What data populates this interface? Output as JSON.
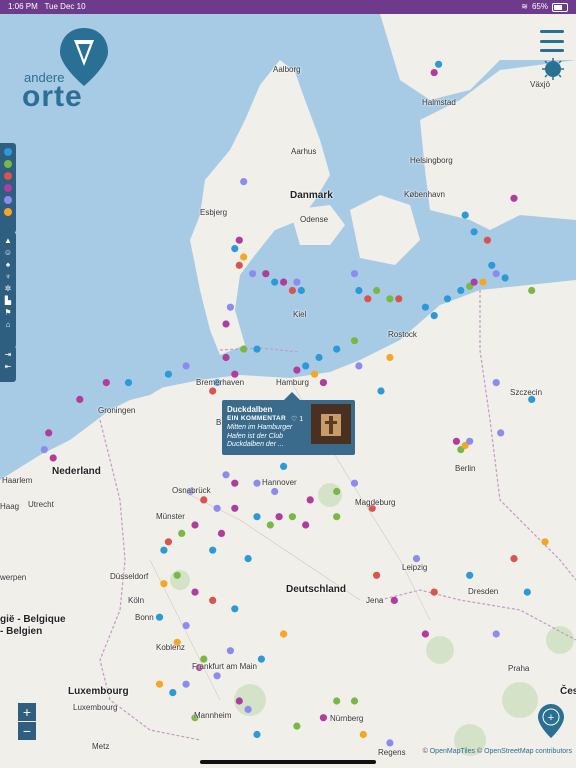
{
  "status_bar": {
    "time": "1:06 PM",
    "date": "Tue Dec 10",
    "battery": "65%"
  },
  "logo": {
    "line1": "andere",
    "line2": "orte"
  },
  "map_labels": {
    "aalborg": "Aalborg",
    "halmstad": "Halmstad",
    "vaxjo": "Växjö",
    "aarhus": "Aarhus",
    "helsingborg": "Helsingborg",
    "danmark": "Danmark",
    "kobenhavn": "København",
    "esbjerg": "Esbjerg",
    "odense": "Odense",
    "kiel": "Kiel",
    "rostock": "Rostock",
    "szczecin": "Szczecin",
    "groningen": "Groningen",
    "bremerhaven": "Bremerhaven",
    "hamburg": "Hamburg",
    "bremen": "Bre",
    "nederland": "Nederland",
    "haarlem": "Haarlem",
    "haag": "Haag",
    "utrecht": "Utrecht",
    "osnabruck": "Osnabrück",
    "hannover": "Hannover",
    "magdeburg": "Magdeburg",
    "berlin": "Berlin",
    "munster": "Münster",
    "dusseldorf": "Düsseldorf",
    "kerpen": "werpen",
    "koln": "Köln",
    "bonn": "Bonn",
    "deutschland": "Deutschland",
    "leipzig": "Leipzig",
    "dresden": "Dresden",
    "jena": "Jena",
    "belgique1": "gië - Belgique",
    "belgique2": "- Belgien",
    "koblenz": "Koblenz",
    "frankfurt": "Frankfurt am Main",
    "praha": "Praha",
    "luxembourg1": "Luxembourg",
    "luxembourg2": "Luxembourg",
    "mannheim": "Mannheim",
    "nurnberg": "Nürnberg",
    "regensburg": "Regens",
    "ceska": "Česk",
    "metz": "Metz"
  },
  "popup": {
    "title": "Duckdalben",
    "subtitle": "EIN KOMMENTAR",
    "likes": "♡ 1",
    "description": "Mitten im Hamburger Hafen ist der Club Duckdalben der ..."
  },
  "zoom": {
    "in": "+",
    "out": "−"
  },
  "attribution": {
    "prefix": "© ",
    "omt": "OpenMapTiles",
    "sep": " © ",
    "osm": "OpenStreetMap contributors"
  },
  "category_colors": [
    "#2c9ad8",
    "#7ab846",
    "#d9534f",
    "#b03c9e",
    "#8c8cf0",
    "#f5a623"
  ],
  "feature_icons": [
    "tent-icon",
    "smiley-icon",
    "tree-icon",
    "pin-icon",
    "bike-icon",
    "boot-icon",
    "flag-icon",
    "house-icon"
  ],
  "action_icons": [
    "export-icon",
    "import-icon"
  ],
  "markers": [
    {
      "lat": 56.9,
      "lon": 12.8,
      "c": 3
    },
    {
      "lat": 57.0,
      "lon": 12.9,
      "c": 0
    },
    {
      "lat": 55.4,
      "lon": 14.6,
      "c": 3
    },
    {
      "lat": 55.6,
      "lon": 8.5,
      "c": 4
    },
    {
      "lat": 55.2,
      "lon": 13.5,
      "c": 0
    },
    {
      "lat": 55.0,
      "lon": 13.7,
      "c": 0
    },
    {
      "lat": 54.9,
      "lon": 14.0,
      "c": 2
    },
    {
      "lat": 54.6,
      "lon": 14.1,
      "c": 0
    },
    {
      "lat": 54.9,
      "lon": 8.4,
      "c": 3
    },
    {
      "lat": 54.8,
      "lon": 8.3,
      "c": 0
    },
    {
      "lat": 54.7,
      "lon": 8.5,
      "c": 5
    },
    {
      "lat": 54.6,
      "lon": 8.4,
      "c": 2
    },
    {
      "lat": 54.5,
      "lon": 8.7,
      "c": 4
    },
    {
      "lat": 54.5,
      "lon": 9.0,
      "c": 3
    },
    {
      "lat": 54.4,
      "lon": 9.2,
      "c": 0
    },
    {
      "lat": 54.4,
      "lon": 9.4,
      "c": 3
    },
    {
      "lat": 54.4,
      "lon": 9.7,
      "c": 4
    },
    {
      "lat": 54.3,
      "lon": 9.8,
      "c": 0
    },
    {
      "lat": 54.3,
      "lon": 9.6,
      "c": 2
    },
    {
      "lat": 54.5,
      "lon": 11.0,
      "c": 4
    },
    {
      "lat": 54.3,
      "lon": 11.1,
      "c": 0
    },
    {
      "lat": 54.2,
      "lon": 11.3,
      "c": 2
    },
    {
      "lat": 54.3,
      "lon": 11.5,
      "c": 1
    },
    {
      "lat": 54.2,
      "lon": 11.8,
      "c": 1
    },
    {
      "lat": 54.2,
      "lon": 12.0,
      "c": 2
    },
    {
      "lat": 54.1,
      "lon": 12.6,
      "c": 0
    },
    {
      "lat": 54.0,
      "lon": 12.8,
      "c": 0
    },
    {
      "lat": 54.2,
      "lon": 13.1,
      "c": 0
    },
    {
      "lat": 54.3,
      "lon": 13.4,
      "c": 0
    },
    {
      "lat": 54.35,
      "lon": 13.6,
      "c": 1
    },
    {
      "lat": 54.4,
      "lon": 13.7,
      "c": 3
    },
    {
      "lat": 54.4,
      "lon": 13.9,
      "c": 5
    },
    {
      "lat": 54.5,
      "lon": 14.2,
      "c": 4
    },
    {
      "lat": 54.45,
      "lon": 14.4,
      "c": 0
    },
    {
      "lat": 54.3,
      "lon": 15.0,
      "c": 1
    },
    {
      "lat": 54.1,
      "lon": 8.2,
      "c": 4
    },
    {
      "lat": 53.9,
      "lon": 8.1,
      "c": 3
    },
    {
      "lat": 53.6,
      "lon": 8.8,
      "c": 0
    },
    {
      "lat": 53.5,
      "lon": 8.1,
      "c": 3
    },
    {
      "lat": 53.6,
      "lon": 8.5,
      "c": 1
    },
    {
      "lat": 53.3,
      "lon": 8.3,
      "c": 3
    },
    {
      "lat": 53.1,
      "lon": 7.8,
      "c": 2
    },
    {
      "lat": 53.2,
      "lon": 7.9,
      "c": 0
    },
    {
      "lat": 53.4,
      "lon": 7.2,
      "c": 4
    },
    {
      "lat": 53.3,
      "lon": 6.8,
      "c": 0
    },
    {
      "lat": 53.2,
      "lon": 5.9,
      "c": 0
    },
    {
      "lat": 53.2,
      "lon": 5.4,
      "c": 3
    },
    {
      "lat": 53.0,
      "lon": 4.8,
      "c": 3
    },
    {
      "lat": 52.6,
      "lon": 4.1,
      "c": 3
    },
    {
      "lat": 52.4,
      "lon": 4.0,
      "c": 4
    },
    {
      "lat": 52.3,
      "lon": 4.2,
      "c": 3
    },
    {
      "lat": 52.5,
      "lon": 9.6,
      "c": 3
    },
    {
      "lat": 53.35,
      "lon": 9.7,
      "c": 3
    },
    {
      "lat": 53.4,
      "lon": 9.9,
      "c": 0
    },
    {
      "lat": 53.3,
      "lon": 10.1,
      "c": 5
    },
    {
      "lat": 53.2,
      "lon": 10.3,
      "c": 3
    },
    {
      "lat": 53.5,
      "lon": 10.2,
      "c": 0
    },
    {
      "lat": 53.7,
      "lon": 11.0,
      "c": 1
    },
    {
      "lat": 53.6,
      "lon": 10.6,
      "c": 0
    },
    {
      "lat": 53.4,
      "lon": 11.1,
      "c": 4
    },
    {
      "lat": 53.1,
      "lon": 11.6,
      "c": 0
    },
    {
      "lat": 52.9,
      "lon": 9.4,
      "c": 4
    },
    {
      "lat": 52.7,
      "lon": 9.6,
      "c": 5
    },
    {
      "lat": 52.4,
      "lon": 13.4,
      "c": 1
    },
    {
      "lat": 52.45,
      "lon": 13.5,
      "c": 5
    },
    {
      "lat": 52.5,
      "lon": 13.3,
      "c": 3
    },
    {
      "lat": 52.5,
      "lon": 13.6,
      "c": 4
    },
    {
      "lat": 52.2,
      "lon": 9.4,
      "c": 0
    },
    {
      "lat": 52.1,
      "lon": 8.1,
      "c": 4
    },
    {
      "lat": 52.0,
      "lon": 8.3,
      "c": 3
    },
    {
      "lat": 52.0,
      "lon": 8.8,
      "c": 4
    },
    {
      "lat": 51.9,
      "lon": 9.2,
      "c": 4
    },
    {
      "lat": 51.8,
      "lon": 10.0,
      "c": 3
    },
    {
      "lat": 51.9,
      "lon": 10.6,
      "c": 1
    },
    {
      "lat": 52.0,
      "lon": 11.0,
      "c": 4
    },
    {
      "lat": 51.7,
      "lon": 11.4,
      "c": 2
    },
    {
      "lat": 51.6,
      "lon": 10.6,
      "c": 1
    },
    {
      "lat": 51.9,
      "lon": 7.3,
      "c": 4
    },
    {
      "lat": 51.8,
      "lon": 7.6,
      "c": 2
    },
    {
      "lat": 51.7,
      "lon": 7.9,
      "c": 4
    },
    {
      "lat": 51.7,
      "lon": 8.3,
      "c": 3
    },
    {
      "lat": 51.6,
      "lon": 8.8,
      "c": 0
    },
    {
      "lat": 51.5,
      "lon": 9.1,
      "c": 1
    },
    {
      "lat": 51.6,
      "lon": 9.6,
      "c": 1
    },
    {
      "lat": 51.5,
      "lon": 9.9,
      "c": 3
    },
    {
      "lat": 51.6,
      "lon": 9.3,
      "c": 3
    },
    {
      "lat": 51.4,
      "lon": 8.0,
      "c": 3
    },
    {
      "lat": 51.5,
      "lon": 7.4,
      "c": 3
    },
    {
      "lat": 51.4,
      "lon": 7.1,
      "c": 1
    },
    {
      "lat": 51.3,
      "lon": 6.8,
      "c": 2
    },
    {
      "lat": 51.2,
      "lon": 6.7,
      "c": 0
    },
    {
      "lat": 51.2,
      "lon": 7.8,
      "c": 0
    },
    {
      "lat": 51.1,
      "lon": 8.6,
      "c": 0
    },
    {
      "lat": 50.9,
      "lon": 7.0,
      "c": 1
    },
    {
      "lat": 50.8,
      "lon": 6.7,
      "c": 5
    },
    {
      "lat": 50.7,
      "lon": 7.4,
      "c": 3
    },
    {
      "lat": 50.6,
      "lon": 7.8,
      "c": 2
    },
    {
      "lat": 50.5,
      "lon": 8.3,
      "c": 0
    },
    {
      "lat": 50.4,
      "lon": 6.6,
      "c": 0
    },
    {
      "lat": 50.3,
      "lon": 7.2,
      "c": 4
    },
    {
      "lat": 50.1,
      "lon": 7.0,
      "c": 5
    },
    {
      "lat": 50.0,
      "lon": 8.2,
      "c": 4
    },
    {
      "lat": 49.9,
      "lon": 7.6,
      "c": 1
    },
    {
      "lat": 50.2,
      "lon": 9.4,
      "c": 5
    },
    {
      "lat": 49.9,
      "lon": 8.9,
      "c": 0
    },
    {
      "lat": 49.8,
      "lon": 7.5,
      "c": 3
    },
    {
      "lat": 49.7,
      "lon": 7.9,
      "c": 4
    },
    {
      "lat": 49.6,
      "lon": 6.6,
      "c": 5
    },
    {
      "lat": 49.6,
      "lon": 7.2,
      "c": 4
    },
    {
      "lat": 49.5,
      "lon": 6.9,
      "c": 0
    },
    {
      "lat": 49.4,
      "lon": 8.4,
      "c": 3
    },
    {
      "lat": 49.3,
      "lon": 8.6,
      "c": 4
    },
    {
      "lat": 49.2,
      "lon": 7.4,
      "c": 1
    },
    {
      "lat": 49.0,
      "lon": 8.8,
      "c": 0
    },
    {
      "lat": 49.1,
      "lon": 9.7,
      "c": 1
    },
    {
      "lat": 49.2,
      "lon": 10.3,
      "c": 3
    },
    {
      "lat": 49.4,
      "lon": 10.6,
      "c": 1
    },
    {
      "lat": 49.4,
      "lon": 11.0,
      "c": 1
    },
    {
      "lat": 49.0,
      "lon": 11.2,
      "c": 5
    },
    {
      "lat": 48.9,
      "lon": 11.8,
      "c": 4
    },
    {
      "lat": 50.2,
      "lon": 12.6,
      "c": 3
    },
    {
      "lat": 50.9,
      "lon": 11.5,
      "c": 2
    },
    {
      "lat": 50.6,
      "lon": 11.9,
      "c": 3
    },
    {
      "lat": 51.1,
      "lon": 12.4,
      "c": 4
    },
    {
      "lat": 50.7,
      "lon": 12.8,
      "c": 2
    },
    {
      "lat": 50.9,
      "lon": 13.6,
      "c": 0
    },
    {
      "lat": 50.2,
      "lon": 14.2,
      "c": 4
    },
    {
      "lat": 51.1,
      "lon": 14.6,
      "c": 2
    },
    {
      "lat": 50.7,
      "lon": 14.9,
      "c": 0
    },
    {
      "lat": 51.3,
      "lon": 15.3,
      "c": 5
    },
    {
      "lat": 52.6,
      "lon": 14.3,
      "c": 4
    },
    {
      "lat": 53.0,
      "lon": 15.0,
      "c": 0
    },
    {
      "lat": 53.2,
      "lon": 14.2,
      "c": 4
    },
    {
      "lat": 53.5,
      "lon": 11.8,
      "c": 5
    }
  ]
}
